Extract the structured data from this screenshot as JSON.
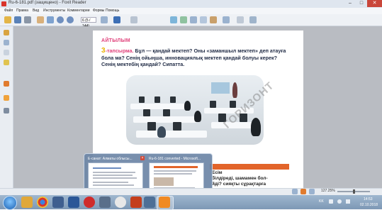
{
  "window": {
    "title": "Ru-6-181.pdf (защищено) - Foxit Reader",
    "min_label": "–",
    "max_label": "□",
    "close_label": "✕"
  },
  "menu": [
    "Файл",
    "Правка",
    "Вид",
    "Инструменты",
    "Комментарии",
    "Формы",
    "Помощь"
  ],
  "toolbar": {
    "page_field": "6 (5 / 144)",
    "icons": [
      "open-icon",
      "save-icon",
      "print-icon",
      "hand-icon",
      "select-icon",
      "zoom-icon",
      "prev-page-icon",
      "next-page-icon",
      "search-icon",
      "fit-page-icon",
      "rotate-icon"
    ]
  },
  "sidebar": {
    "icons": [
      "bookmarks-icon",
      "pages-icon",
      "layers-icon",
      "attachments-icon",
      "comments-icon",
      "signature-icon"
    ]
  },
  "document": {
    "section_title": "АЙТЫЛЫМ",
    "task_number": "3",
    "task_label": "-тапсырма.",
    "task_text": "Бұл — қандай мектеп? Оны «заманшыл мектеп» деп атауға бола ма? Сенің ойыңша, инновациялық мектеп қандай болуы керек? Сенің мектебің қандай? Сипатта.",
    "watermark": "ГОРИЗОНТ",
    "bottom_heading": "Есім",
    "bottom_line1": "білдіреді, шамамен бол-",
    "bottom_line2": "йді? сияқты сұрақтарға"
  },
  "thumbnails": [
    {
      "title": "E-санат: Алматы облысы..."
    },
    {
      "title": "Ru-6-181 converted - Microsoft..."
    }
  ],
  "statusbar": {
    "zoom": "127.25%"
  },
  "taskbar": {
    "language": "KK",
    "time": "14:53",
    "date": "02.10.2018",
    "apps": [
      "explorer-icon",
      "chrome-icon",
      "media-icon",
      "word-icon",
      "opera-icon",
      "files-icon",
      "yandex-icon",
      "ppt-icon",
      "foxit-icon",
      "paint-icon"
    ]
  },
  "colors": {
    "accent_pink": "#e0407a",
    "accent_orange": "#e2642a",
    "task_number": "#e9b300"
  }
}
